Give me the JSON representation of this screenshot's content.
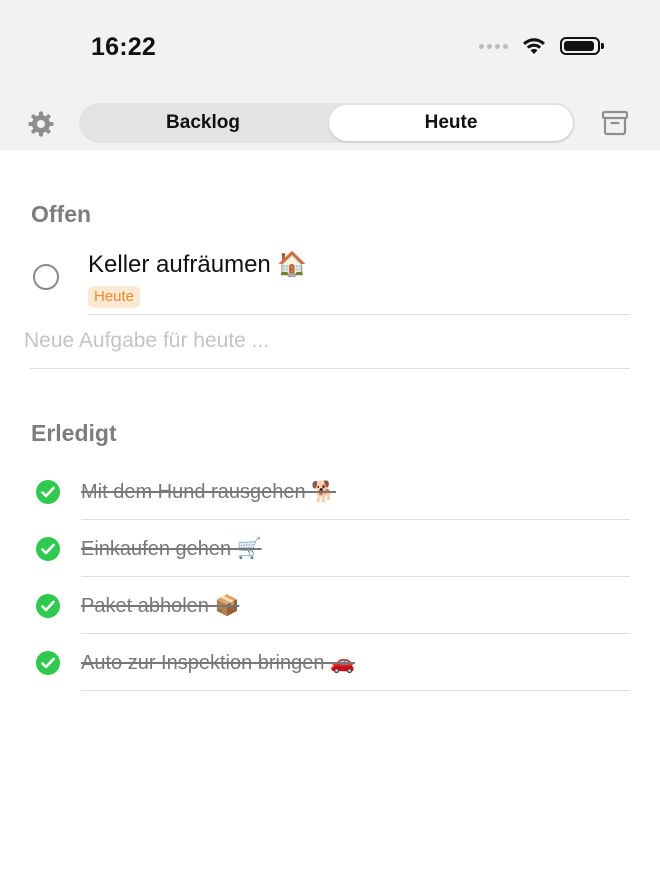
{
  "status_bar": {
    "time": "16:22"
  },
  "header": {
    "settings_icon": "gear-icon",
    "archive_icon": "archive-icon",
    "tabs": [
      {
        "label": "Backlog",
        "selected": false
      },
      {
        "label": "Heute",
        "selected": true
      }
    ]
  },
  "open_section": {
    "title": "Offen",
    "items": [
      {
        "title": "Keller aufräumen 🏠",
        "tag": "Heute",
        "done": false
      }
    ],
    "new_task_placeholder": "Neue Aufgabe für heute ..."
  },
  "done_section": {
    "title": "Erledigt",
    "items": [
      {
        "title": "Mit dem Hund rausgehen 🐕",
        "done": true
      },
      {
        "title": "Einkaufen gehen 🛒",
        "done": true
      },
      {
        "title": "Paket abholen 📦",
        "done": true
      },
      {
        "title": "Auto zur Inspektion bringen 🚗",
        "done": true
      }
    ]
  },
  "colors": {
    "check_green": "#2fc94f",
    "tag_text": "#f08a24",
    "tag_bg": "#fde8d4",
    "section_title": "#7d7d7d"
  }
}
